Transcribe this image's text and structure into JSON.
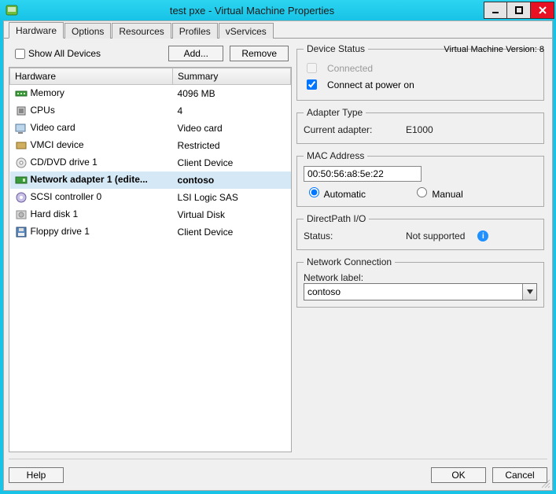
{
  "title": "test pxe - Virtual Machine Properties",
  "vm_version": "Virtual Machine Version: 8",
  "tabs": {
    "hardware": "Hardware",
    "options": "Options",
    "resources": "Resources",
    "profiles": "Profiles",
    "vservices": "vServices"
  },
  "left": {
    "show_all": "Show All Devices",
    "add": "Add...",
    "remove": "Remove",
    "cols": {
      "hardware": "Hardware",
      "summary": "Summary"
    },
    "rows": [
      {
        "icon": "memory-icon",
        "name": "Memory",
        "summary": "4096 MB"
      },
      {
        "icon": "cpu-icon",
        "name": "CPUs",
        "summary": "4"
      },
      {
        "icon": "video-icon",
        "name": "Video card",
        "summary": "Video card"
      },
      {
        "icon": "vmci-icon",
        "name": "VMCI device",
        "summary": "Restricted"
      },
      {
        "icon": "cd-icon",
        "name": "CD/DVD drive 1",
        "summary": "Client Device"
      },
      {
        "icon": "nic-icon",
        "name": "Network adapter 1 (edite...",
        "summary": "contoso",
        "selected": true
      },
      {
        "icon": "scsi-icon",
        "name": "SCSI controller 0",
        "summary": "LSI Logic SAS"
      },
      {
        "icon": "disk-icon",
        "name": "Hard disk 1",
        "summary": "Virtual Disk"
      },
      {
        "icon": "floppy-icon",
        "name": "Floppy drive 1",
        "summary": "Client Device"
      }
    ]
  },
  "right": {
    "device_status": {
      "legend": "Device Status",
      "connected": "Connected",
      "connect_power": "Connect at power on"
    },
    "adapter_type": {
      "legend": "Adapter Type",
      "label": "Current adapter:",
      "value": "E1000"
    },
    "mac": {
      "legend": "MAC Address",
      "value": "00:50:56:a8:5e:22",
      "automatic": "Automatic",
      "manual": "Manual"
    },
    "directpath": {
      "legend": "DirectPath I/O",
      "status_label": "Status:",
      "status_value": "Not supported"
    },
    "netconn": {
      "legend": "Network Connection",
      "label": "Network label:",
      "value": "contoso"
    }
  },
  "footer": {
    "help": "Help",
    "ok": "OK",
    "cancel": "Cancel"
  }
}
